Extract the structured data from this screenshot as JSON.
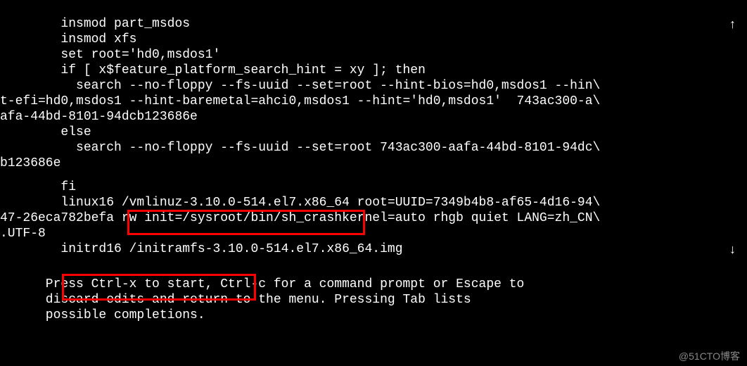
{
  "grub_editor": {
    "script_lines": {
      "l1": "        insmod part_msdos",
      "l2": "        insmod xfs",
      "l3": "        set root='hd0,msdos1'",
      "l4": "        if [ x$feature_platform_search_hint = xy ]; then",
      "l5": "          search --no-floppy --fs-uuid --set=root --hint-bios=hd0,msdos1 --hin\\",
      "l6": "t-efi=hd0,msdos1 --hint-baremetal=ahci0,msdos1 --hint='hd0,msdos1'  743ac300-a\\",
      "l7": "afa-44bd-8101-94dcb123686e",
      "l8": "        else",
      "l9": "          search --no-floppy --fs-uuid --set=root 743ac300-aafa-44bd-8101-94dc\\",
      "l10": "b123686e",
      "l11": "        fi",
      "l12": "        linux16 /vmlinuz-3.10.0-514.el7.x86_64 root=UUID=7349b4b8-af65-4d16-94\\",
      "l13": "47-26eca782befa rw init=/sysroot/bin/sh_crashkernel=auto rhgb quiet LANG=zh_CN\\",
      "l14": ".UTF-8",
      "l15": "        initrd16 /initramfs-3.10.0-514.el7.x86_64.img"
    },
    "help_lines": {
      "h1": "      Press Ctrl-x to start, Ctrl-c for a command prompt or Escape to",
      "h2": "      discard edits and return to the menu. Pressing Tab lists",
      "h3": "      possible completions."
    },
    "arrows": {
      "up": "↑",
      "down": "↓"
    }
  },
  "watermark": "@51CTO博客"
}
